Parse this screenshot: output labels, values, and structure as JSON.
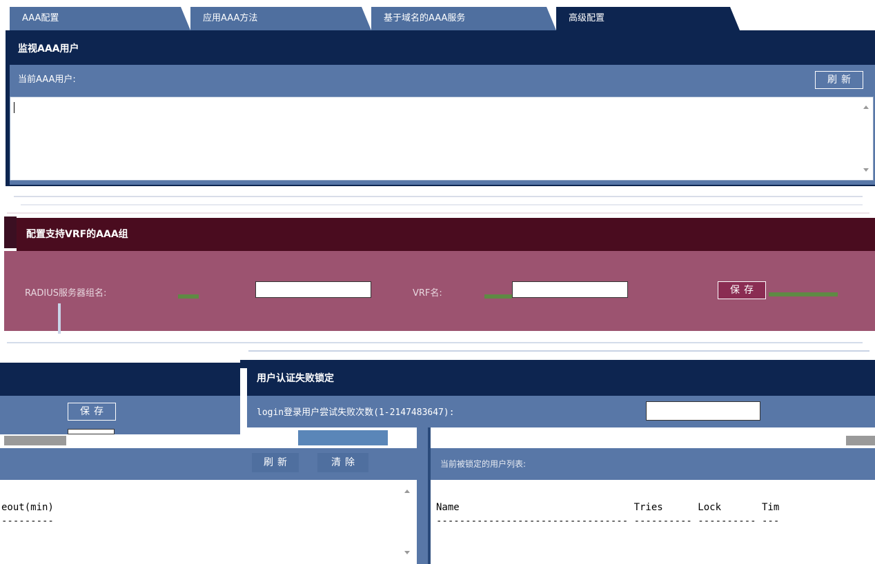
{
  "tabs": [
    {
      "label": "AAA配置"
    },
    {
      "label": "应用AAA方法"
    },
    {
      "label": "基于域名的AAA服务"
    },
    {
      "label": "高级配置"
    }
  ],
  "monitor": {
    "title": "监视AAA用户",
    "current_label": "当前AAA用户:",
    "refresh_label": "刷新"
  },
  "vrf_group": {
    "title": "配置支持VRF的AAA组",
    "radius_label": "RADIUS服务器组名:",
    "vrf_label": "VRF名:",
    "save_label": "保存"
  },
  "left_panel": {
    "save_label": "保存",
    "refresh_label": "刷新",
    "clear_label": "清除",
    "output_line1": "eout(min)",
    "output_line2": "---------"
  },
  "lockout": {
    "title": "用户认证失败锁定",
    "login_attempts_label": "login登录用户尝试失败次数(1-2147483647):",
    "list_label": "当前被锁定的用户列表:",
    "table_header": "Name                              Tries      Lock       Tim",
    "table_rule": "--------------------------------- ---------- ---------- ---"
  },
  "colors": {
    "navy": "#0d2550",
    "panel_blue": "#5877a7",
    "maroon": "#4a0c1f",
    "rose": "#9c5370"
  }
}
